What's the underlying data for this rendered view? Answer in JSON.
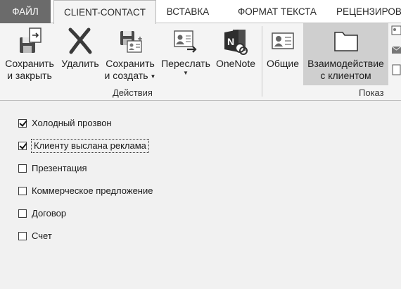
{
  "tabs": {
    "file": "ФАЙЛ",
    "client_contact": "CLIENT-CONTACT",
    "insert": "ВСТАВКА",
    "format_text": "ФОРМАТ ТЕКСТА",
    "review": "РЕЦЕНЗИРОВ"
  },
  "ribbon": {
    "actions": {
      "save_close_line1": "Сохранить",
      "save_close_line2": "и закрыть",
      "delete": "Удалить",
      "save_new_line1": "Сохранить",
      "save_new_line2": "и создать",
      "forward": "Переслать",
      "onenote": "OneNote",
      "group_label": "Действия"
    },
    "show": {
      "general": "Общие",
      "interaction_line1": "Взаимодействие",
      "interaction_line2": "с клиентом",
      "group_label": "Показ"
    }
  },
  "checklist": [
    {
      "label": "Холодный прозвон",
      "checked": true
    },
    {
      "label": "Клиенту выслана реклама",
      "checked": true
    },
    {
      "label": "Презентация",
      "checked": false
    },
    {
      "label": "Коммерческое предложение",
      "checked": false
    },
    {
      "label": "Договор",
      "checked": false
    },
    {
      "label": "Счет",
      "checked": false
    }
  ]
}
